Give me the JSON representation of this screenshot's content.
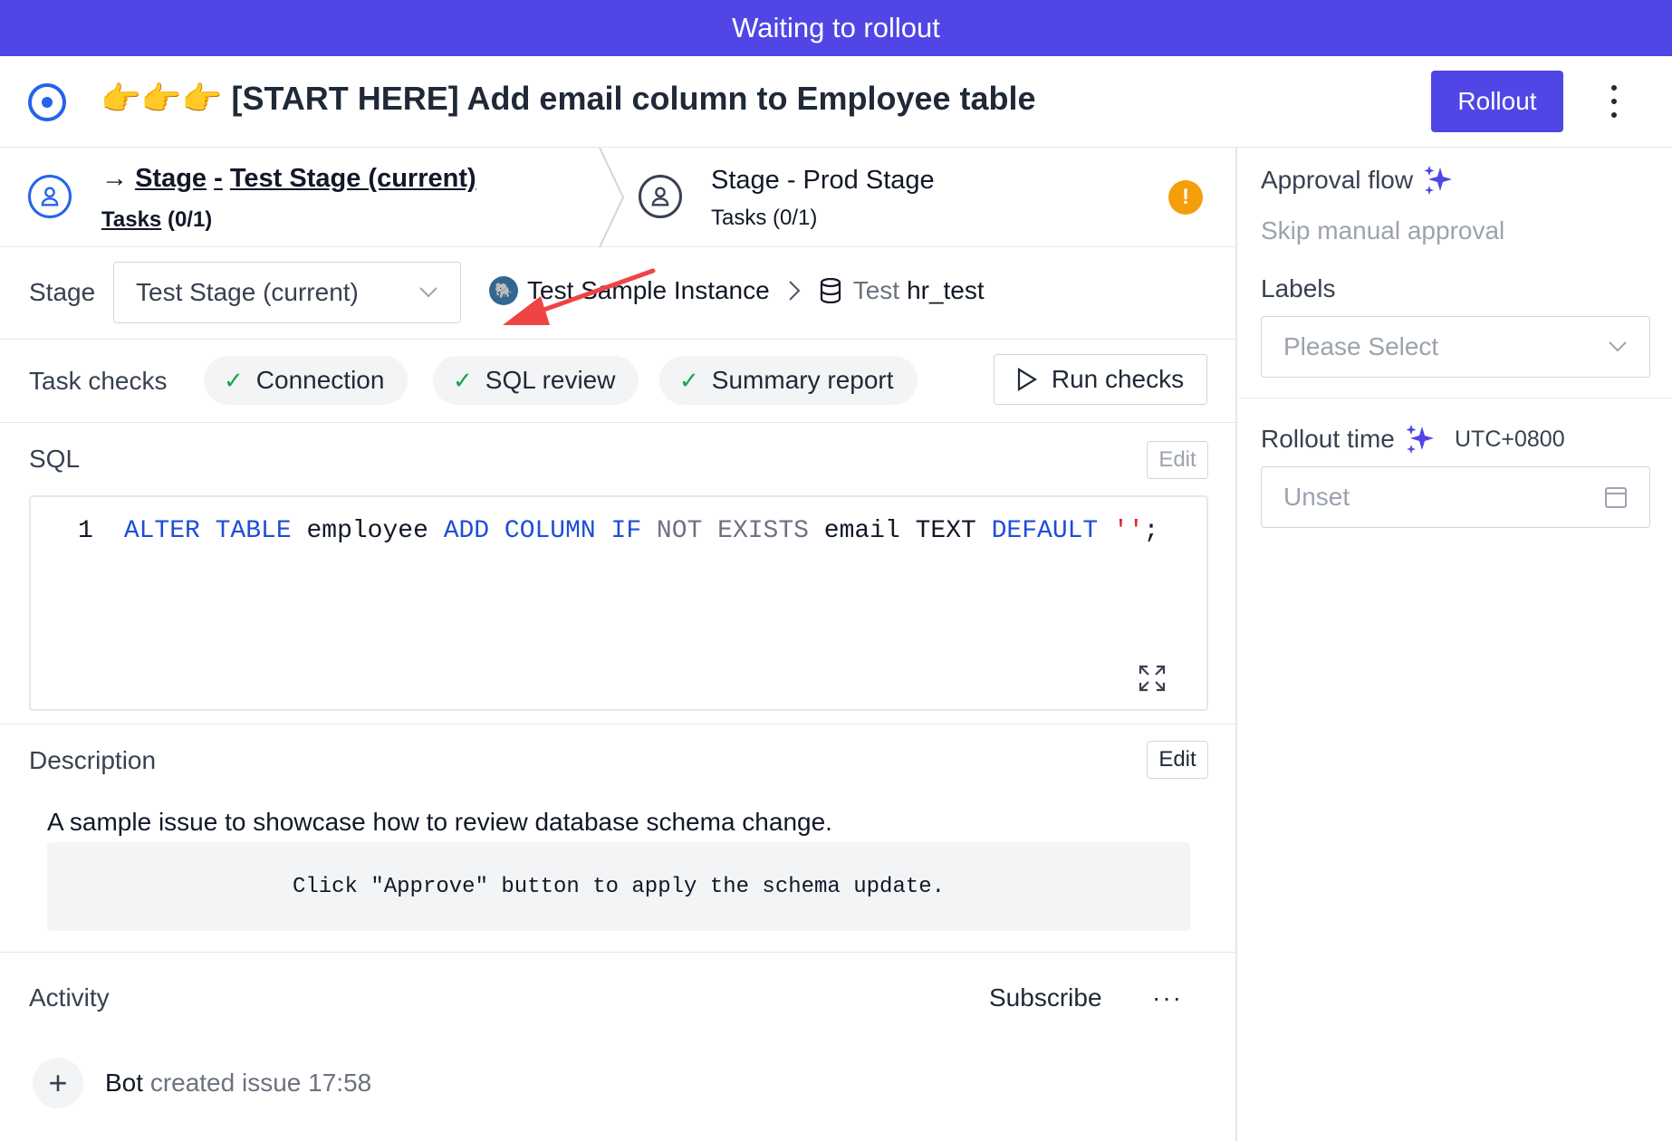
{
  "banner": {
    "text": "Waiting to rollout"
  },
  "header": {
    "title": "👉👉👉 [START HERE] Add email column to Employee table",
    "rollout_label": "Rollout"
  },
  "stages": [
    {
      "arrow": "→",
      "prefix": "Stage",
      "sep": "-",
      "name": "Test Stage (current)",
      "tasks_label": "Tasks",
      "tasks_count": "(0/1)"
    },
    {
      "full_name": "Stage - Prod Stage",
      "tasks": "Tasks (0/1)",
      "warning": "!"
    }
  ],
  "stage_row": {
    "label": "Stage",
    "selected": "Test Stage (current)",
    "instance": "Test Sample Instance",
    "environment": "Test",
    "database": "hr_test"
  },
  "task_checks": {
    "label": "Task checks",
    "chips": [
      "Connection",
      "SQL review",
      "Summary report"
    ],
    "run_label": "Run checks"
  },
  "sql": {
    "title": "SQL",
    "edit_label": "Edit",
    "line_number": "1",
    "tokens": {
      "t1": "ALTER TABLE",
      "t2": " employee ",
      "t3": "ADD COLUMN IF",
      "t4": " NOT EXISTS",
      "t5": " email TEXT ",
      "t6": "DEFAULT",
      "t7": " ''",
      "t8": ";"
    }
  },
  "description": {
    "title": "Description",
    "edit_label": "Edit",
    "text": "A sample issue to showcase how to review database schema change.",
    "code": "Click \"Approve\" button to apply the schema update."
  },
  "activity": {
    "title": "Activity",
    "subscribe_label": "Subscribe",
    "more": "···",
    "entry": {
      "user": "Bot",
      "action": "created issue",
      "time": "17:58"
    }
  },
  "sidebar": {
    "approval_title": "Approval flow",
    "approval_value": "Skip manual approval",
    "labels_title": "Labels",
    "labels_placeholder": "Please Select",
    "rollout_time_title": "Rollout time",
    "timezone": "UTC+0800",
    "rollout_time_placeholder": "Unset"
  },
  "colors": {
    "accent": "#4f46e5",
    "stage_active": "#2563eb",
    "warning": "#f59e0b",
    "check": "#16a34a",
    "annotation_arrow": "#ef4444"
  },
  "icons": [
    "status-dot-icon",
    "user-icon",
    "warning-icon",
    "postgres-icon",
    "database-icon",
    "check-icon",
    "play-icon",
    "expand-icon",
    "sparkle-icon",
    "calendar-icon",
    "chevron-down-icon",
    "chevron-right-icon",
    "plus-icon"
  ]
}
